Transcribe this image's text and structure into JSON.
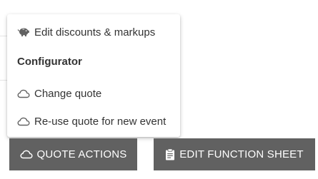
{
  "menu": {
    "items": [
      {
        "label": "Edit discounts & markups",
        "icon": "piggy-bank-icon"
      },
      {
        "label": "Change quote",
        "icon": "cloud-icon"
      },
      {
        "label": "Re-use quote for new event",
        "icon": "cloud-icon"
      }
    ],
    "section_header": "Configurator"
  },
  "buttons": {
    "quote_actions": {
      "label": "QUOTE ACTIONS",
      "icon": "cloud-icon"
    },
    "edit_function_sheet": {
      "label": "EDIT FUNCTION SHEET",
      "icon": "clipboard-icon"
    }
  },
  "colors": {
    "button_bg": "#616161",
    "button_text": "#ffffff",
    "menu_text": "#333333"
  }
}
